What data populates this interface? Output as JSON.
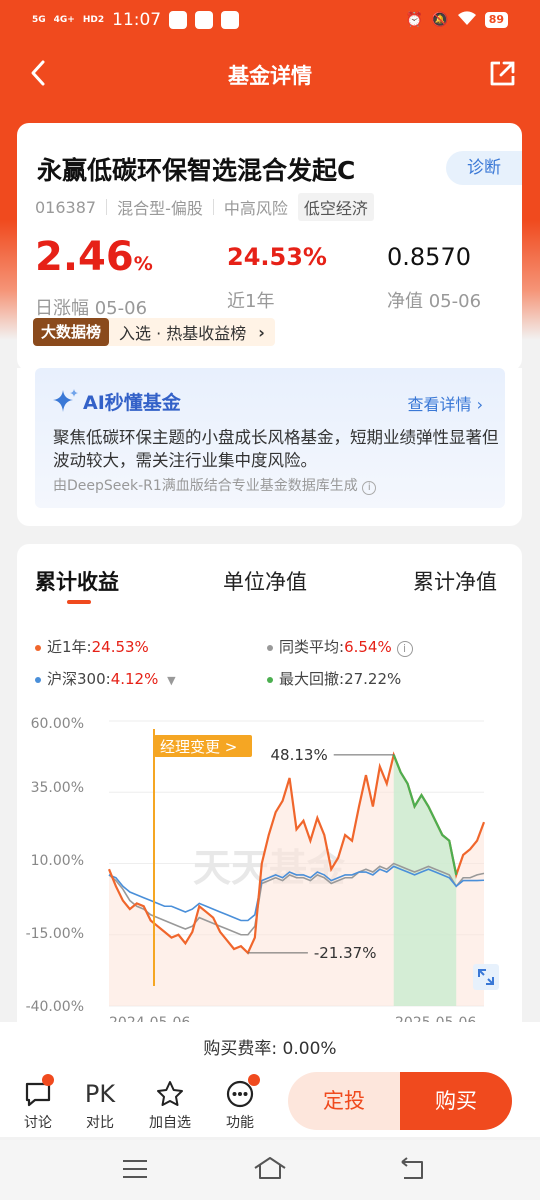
{
  "status_bar": {
    "time": "11:07",
    "sig1": "5G",
    "sig2": "4G+",
    "hd": "HD2",
    "battery": "89"
  },
  "nav": {
    "title": "基金详情"
  },
  "fund": {
    "name": "永赢低碳环保智选混合发起C",
    "diagnose": "诊断",
    "code": "016387",
    "type": "混合型-偏股",
    "risk": "中高风险",
    "theme": "低空经济",
    "daily_value": "2.46",
    "daily_unit": "%",
    "daily_label": "日涨幅 05-06",
    "year_value": "24.53%",
    "year_label": "近1年",
    "nav_value": "0.8570",
    "nav_label": "净值 05-06",
    "rank_badge": "大数据榜",
    "rank_text": "入选 · 热基收益榜"
  },
  "ai": {
    "title": "AI秒懂基金",
    "more": "查看详情",
    "desc": "聚焦低碳环保主题的小盘成长风格基金，短期业绩弹性显著但波动较大，需关注行业集中度风险。",
    "foot": "由DeepSeek-R1满血版结合专业基金数据库生成"
  },
  "chart_tabs": [
    "累计收益",
    "单位净值",
    "累计净值"
  ],
  "legend": {
    "fund_label": "近1年:",
    "fund_value": "24.53%",
    "peer_label": "同类平均:",
    "peer_value": "6.54%",
    "index_label": "沪深300:",
    "index_value": "4.12%",
    "dd_label": "最大回撤:",
    "dd_value": "27.22%"
  },
  "colors": {
    "accent": "#f04a1e",
    "fund": "#f0662c",
    "peer": "#999999",
    "index": "#4a8fd9",
    "drawdown": "#4caf50"
  },
  "chart_data": {
    "type": "line",
    "ylim": [
      -40,
      60
    ],
    "y_ticks": [
      "60.00%",
      "35.00%",
      "10.00%",
      "-15.00%",
      "-40.00%"
    ],
    "x_labels": [
      "2024-05-06",
      "2025-05-06"
    ],
    "watermark": "天天基金",
    "manager_change_label": "经理变更 >",
    "max_label": "48.13%",
    "min_label": "-21.37%",
    "series": [
      {
        "name": "近1年",
        "values": [
          8,
          2,
          -3,
          -6,
          -4,
          -5,
          -10,
          -12,
          -14,
          -16,
          -15,
          -18,
          -14,
          -5,
          -7,
          -9,
          -14,
          -17,
          -20,
          -19,
          -21.37,
          -16,
          10,
          20,
          28,
          32,
          40,
          22,
          25,
          18,
          26,
          20,
          8,
          12,
          20,
          18,
          30,
          41,
          30,
          44,
          38,
          48.13,
          42,
          38,
          30,
          34,
          30,
          25,
          20,
          18,
          6,
          13,
          15,
          18,
          24.53
        ]
      },
      {
        "name": "同类平均",
        "values": [
          6,
          4,
          1,
          -3,
          -5,
          -6,
          -8,
          -9,
          -10,
          -11,
          -12,
          -13,
          -12,
          -9,
          -10,
          -11,
          -12,
          -13,
          -14,
          -15,
          -15,
          -12,
          3,
          4,
          5,
          4,
          6,
          5,
          5,
          4,
          6,
          5,
          3,
          4,
          5,
          5,
          7,
          8,
          7,
          9,
          8,
          10,
          9,
          8,
          7,
          8,
          9,
          8,
          7,
          6,
          2,
          5,
          5,
          6,
          6.54
        ]
      },
      {
        "name": "沪深300",
        "values": [
          6,
          5,
          2,
          0,
          -1,
          -2,
          -3,
          -4,
          -5,
          -5,
          -6,
          -7,
          -6,
          -4,
          -5,
          -6,
          -7,
          -8,
          -9,
          -10,
          -10,
          -8,
          4,
          5,
          6,
          5,
          7,
          6,
          6,
          5,
          7,
          6,
          4,
          5,
          6,
          6,
          7,
          7,
          6,
          8,
          7,
          9,
          8,
          7,
          6,
          7,
          8,
          7,
          6,
          5,
          2,
          4,
          4,
          4,
          4.12
        ]
      }
    ]
  },
  "bottom": {
    "fee_label": "购买费率: 0.00%",
    "items": [
      "讨论",
      "对比",
      "加自选",
      "功能"
    ],
    "pk": "PK",
    "btn_invest": "定投",
    "btn_buy": "购买"
  }
}
